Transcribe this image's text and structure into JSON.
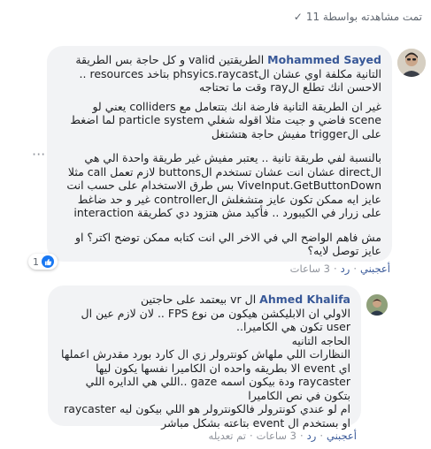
{
  "seen_by": "تمت مشاهدته بواسطة 11",
  "comment1": {
    "author": "Mohammed Sayed",
    "paragraphs": [
      "الطريقتين valid و كل حاجة بس الطريقة التانية مكلفة اوي عشان الphsyics.raycast بتاخد resources .. الاحسن انك تطلع الray وقت ما تحتاجه",
      "غير ان الطريقة التانية فارضة انك بتتعامل مع colliders يعني لو scene فاضي و جيت مثلا اقوله شغلي particle system لما اضغط على الtrigger مفيش حاجة هتشتغل",
      "بالنسبة لفي طريقة تانية .. يعتبر مفيش غير طريقة واحدة الي هي الdirect عشان انت عشان تستخدم الbuttons لازم تعمل call مثلا ViveInput.GetButtonDown بس طرق الاستخدام على حسب انت عايز ايه ممكن تكون عايز متشغلش الcontroller غير و حد ضاغط على زرار في الكيبورد .. فأكيد مش هتزود دي كطريقة interaction",
      "مش فاهم الواضح الي في الاخر الي انت كتابه ممكن توضح اكتر؟ او عايز توصل لايه؟"
    ],
    "reaction_count": "1",
    "actions": [
      "أعجبني",
      "رد",
      "3 ساعات"
    ]
  },
  "comment2": {
    "author": "Ahmed Khalifa",
    "paragraphs": [
      "ال vr بيعتمد على حاجتين\nالاولي ان الابليكشن هيكون من نوع FPS .. لان لازم عين ال user تكون هي الكاميرا..\nالحاجه التانيه\nالنظارات اللي ملهاش كونترولر زي ال كارد بورد مقدرش اعملها اي event الا بطريقه واحده ان الكاميرا نفسها يكون ليها raycaster ودة بيكون اسمه gaze ..اللي هي الدايره اللي بتكون في نص الكاميرا\nام لو عندي كونترولر فالكونترولر هو اللي بيكون ليه raycaster او بستخدم ال event بتاعته بشكل مباشر"
    ],
    "actions": [
      "أعجبني",
      "رد",
      "3 ساعات",
      "تم تعديله"
    ]
  },
  "icons": {
    "seen": "check-icon",
    "more": "more-options-icon",
    "like": "like-thumb-icon"
  },
  "colors": {
    "name": "#385898",
    "bubble": "#f2f3f5",
    "like": "#1877f2"
  }
}
